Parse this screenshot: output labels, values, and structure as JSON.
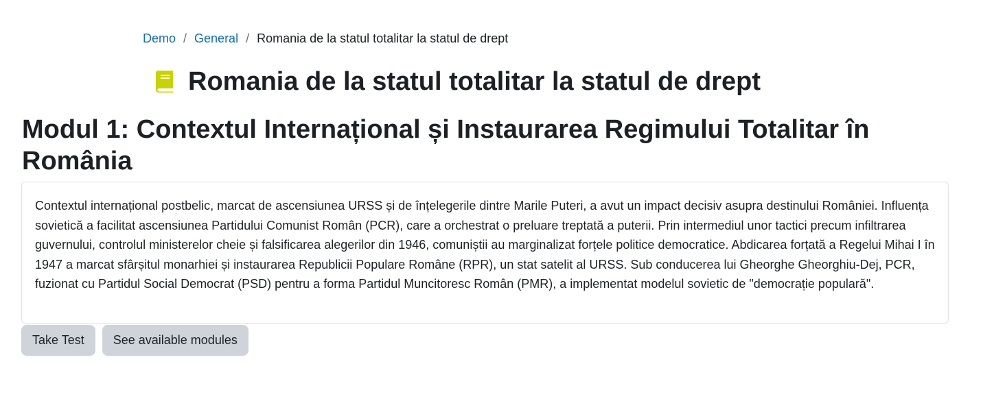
{
  "breadcrumb": {
    "items": [
      "Demo",
      "General"
    ],
    "separator": "/",
    "current": "Romania de la statul totalitar la statul de drept"
  },
  "header": {
    "icon": "book-icon",
    "title": "Romania de la statul totalitar la statul de drept"
  },
  "module": {
    "title": "Modul 1: Contextul Internațional și Instaurarea Regimului Totalitar în România",
    "content": "Contextul internațional postbelic, marcat de ascensiunea URSS și de înțelegerile dintre Marile Puteri, a avut un impact decisiv asupra destinului României. Influența sovietică a facilitat ascensiunea Partidului Comunist Român (PCR), care a orchestrat o preluare treptată a puterii. Prin intermediul unor tactici precum infiltrarea guvernului, controlul ministerelor cheie și falsificarea alegerilor din 1946, comuniștii au marginalizat forțele politice democratice. Abdicarea forțată a Regelui Mihai I în 1947 a marcat sfârșitul monarhiei și instaurarea Republicii Populare Române (RPR), un stat satelit al URSS. Sub conducerea lui Gheorghe Gheorghiu-Dej, PCR, fuzionat cu Partidul Social Democrat (PSD) pentru a forma Partidul Muncitoresc Român (PMR), a implementat modelul sovietic de \"democrație populară\"."
  },
  "actions": {
    "take_test": "Take Test",
    "see_modules": "See available modules"
  },
  "colors": {
    "link": "#0f6cbf",
    "icon": "#c8d400",
    "button_bg": "#ced4da",
    "text": "#1d2125"
  }
}
